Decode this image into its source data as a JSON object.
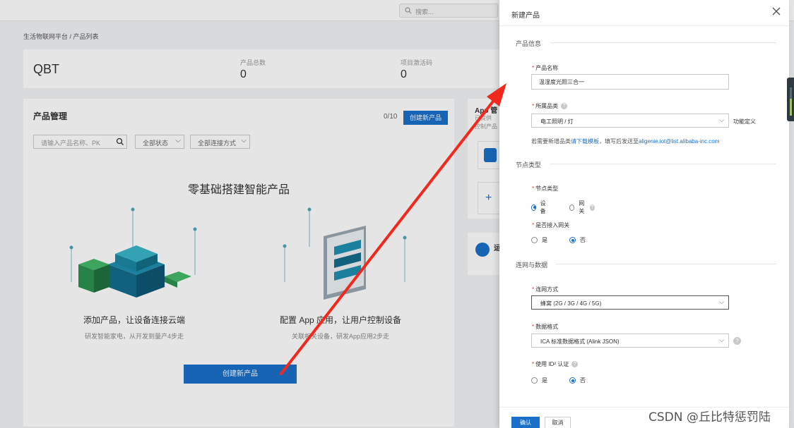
{
  "topbar": {
    "search_placeholder": "搜索..."
  },
  "breadcrumb": "生活物联网平台 / 产品列表",
  "project": {
    "name": "QBT",
    "stats": [
      {
        "label": "产品总数",
        "value": "0"
      },
      {
        "label": "项目激活码",
        "value": "0"
      }
    ]
  },
  "management": {
    "title": "产品管理",
    "count": "0/10",
    "create_button": "创建新产品",
    "search_placeholder": "请输入产品名称、PK",
    "filter_status": "全部状态",
    "filter_network": "全部连接方式",
    "hero_title": "零基础搭建智能产品",
    "feature1_title": "添加产品，让设备连接云端",
    "feature1_sub": "研发智能家电，从开发到量产4步走",
    "feature2_title": "配置 App 应用，让用户控制设备",
    "feature2_sub": "关联相关设备，研发App应用2步走",
    "hero_button": "创建新产品"
  },
  "side": {
    "card1_title": "App 管",
    "card1_line1": "已提供",
    "card1_line2": "控制产品",
    "card3_title": "运"
  },
  "drawer": {
    "title": "新建产品",
    "section_product": "产品信息",
    "label_name": "产品名称",
    "name_value": "温湿度光照三合一",
    "label_category": "所属品类",
    "category_value": "电工照明 / 灯",
    "category_link": "功能定义",
    "hint_prefix": "若需要新增品类",
    "hint_link": "请下载模板",
    "hint_middle": "，填写后发送至",
    "hint_email": "aligenie.iot@list.alibaba-inc.com",
    "section_node": "节点类型",
    "label_node_type": "节点类型",
    "node_device": "设备",
    "node_gateway": "网关",
    "label_gateway_access": "是否接入网关",
    "yes": "是",
    "no": "否",
    "section_network": "连网与数据",
    "label_network": "连网方式",
    "network_value": "蜂窝 (2G / 3G / 4G / 5G)",
    "label_data_format": "数据格式",
    "data_format_value": "ICA 标准数据格式 (Alink JSON)",
    "label_id2": "使用 ID² 认证",
    "confirm": "确认",
    "cancel": "取消"
  },
  "watermark": "CSDN @丘比特惩罚陆",
  "colors": {
    "primary": "#1a6fc9",
    "required": "#e4393c",
    "annotation_arrow": "#f0281e"
  }
}
